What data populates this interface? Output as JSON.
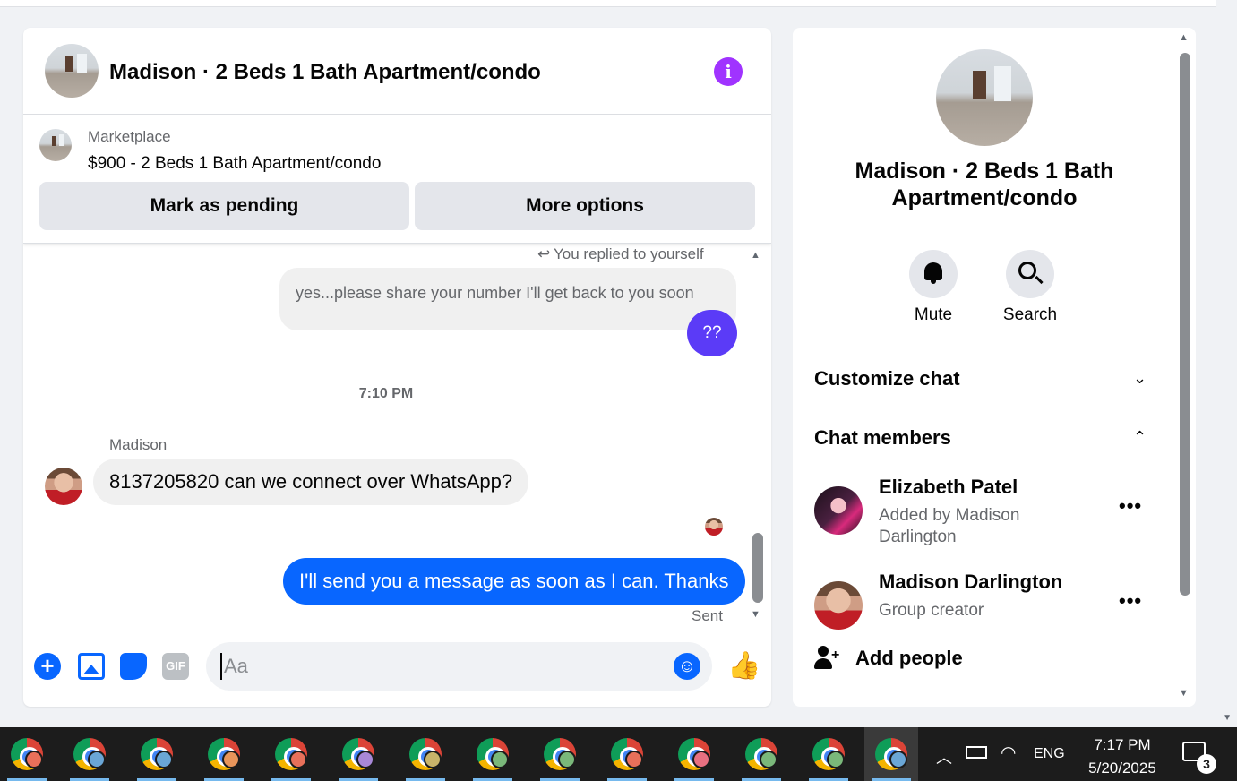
{
  "chat": {
    "title": "Madison · 2 Beds 1 Bath Apartment/condo",
    "marketplace_label": "Marketplace",
    "listing": "$900 - 2 Beds 1 Bath Apartment/condo",
    "mark_pending_label": "Mark as pending",
    "more_options_label": "More options",
    "replied_note": "You replied to yourself",
    "messages": [
      {
        "text": "yes...please share your number I'll get back to you soon",
        "direction": "outgoing-reply-preview"
      },
      {
        "text": "??",
        "direction": "outgoing"
      },
      {
        "text": "8137205820 can we connect over WhatsApp?",
        "direction": "incoming",
        "sender": "Madison"
      },
      {
        "text": "I'll send you a message as soon as I can. Thanks",
        "direction": "outgoing"
      }
    ],
    "timestamp": "7:10 PM",
    "sent_status": "Sent",
    "composer": {
      "placeholder": "Aa",
      "gif_label": "GIF"
    }
  },
  "side": {
    "title": "Madison · 2 Beds 1 Bath Apartment/condo",
    "actions": [
      {
        "label": "Mute",
        "icon": "bell-icon"
      },
      {
        "label": "Search",
        "icon": "search-icon"
      }
    ],
    "customize_label": "Customize chat",
    "members_label": "Chat members",
    "members": [
      {
        "name": "Elizabeth Patel",
        "sub": "Added by Madison Darlington"
      },
      {
        "name": "Madison Darlington",
        "sub": "Group creator"
      }
    ],
    "add_people_label": "Add people"
  },
  "taskbar": {
    "language": "ENG",
    "time": "7:17 PM",
    "date": "5/20/2025",
    "notifications": "3",
    "profile_colors": [
      "#e8705a",
      "#6aa6d6",
      "#6aa6d6",
      "#e8955a",
      "#e8705a",
      "#a888d8",
      "#c8b46a",
      "#7ab87a",
      "#7ab87a",
      "#e8705a",
      "#e87080",
      "#7ab87a",
      "#7ab87a",
      "#6aa6d6"
    ]
  },
  "colors": {
    "accent": "#0866ff",
    "info": "#a033ff",
    "purple_bubble": "#5b3bf7"
  }
}
